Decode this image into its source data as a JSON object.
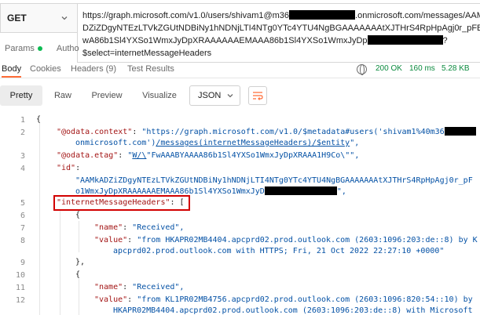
{
  "request": {
    "method": "GET",
    "url_line1_a": "https://graph.microsoft.com/v1.0/users/shivam1@m36",
    "url_line1_b": ".onmicrosoft.com/messages/AAMkA",
    "url_line2": "DZiZDgyNTEzLTVkZGUtNDBiNy1hNDNjLTI4NTg0YTc4YTU4NgBGAAAAAAAtXJTHrS4RpHpAgj0r_pFB",
    "url_line3_a": "wA86b1Sl4YXSo1WmxJyDpXRAAAAAAEMAAA86b1Sl4YXSo1WmxJyDp",
    "url_line3_b": "?",
    "url_line4": "$select=internetMessageHeaders"
  },
  "request_tabs": {
    "params": "Params",
    "auth": "Autho"
  },
  "response_tabs": {
    "body": "Body",
    "cookies": "Cookies",
    "headers": "Headers (9)",
    "test_results": "Test Results",
    "status": "200 OK",
    "time": "160 ms",
    "size": "5.28 KB"
  },
  "format_bar": {
    "pretty": "Pretty",
    "raw": "Raw",
    "preview": "Preview",
    "visualize": "Visualize",
    "format": "JSON"
  },
  "code": {
    "line_numbers": [
      "1",
      "2",
      "3",
      "4",
      "5",
      "6",
      "7",
      "8",
      "9",
      "10",
      "11",
      "12"
    ],
    "l1": "{",
    "l2_key": "\"@odata.context\"",
    "l2_sep": ": ",
    "l2_val": "\"https://graph.microsoft.com/v1.0/$metadata#users('shivam1%40m36",
    "l2_cont_a": "onmicrosoft.com')",
    "l2_cont_b": "/messages(internetMessageHeaders)/$entity",
    "l2_cont_c": "\",",
    "l3_key": "\"@odata.etag\"",
    "l3_sep": ": ",
    "l3_q": "\"",
    "l3_link": "W/\\",
    "l3_val": "\"FwAAABYAAAA86b1Sl4YXSo1WmxJyDpXRAAA1H9Co\\\"\",",
    "l4_key": "\"id\"",
    "l4_sep": ":",
    "l4_val_a": "\"AAMkADZiZDgyNTEzLTVkZGUtNDBiNy1hNDNjLTI4NTg0YTc4YTU4NgBGAAAAAAAtXJTHrS4RpHpAgj0r_pF",
    "l4_val_b": "o1WmxJyDpXRAAAAAAEMAAA86b1Sl4YXSo1WmxJyD",
    "l4_val_c": "\",",
    "l5_key": "\"internetMessageHeaders\"",
    "l5_rest": ": [",
    "l6": "{",
    "l7_key": "\"name\"",
    "l7_val": "\"Received\",",
    "l8_key": "\"value\"",
    "l8_val": "\"from HKAPR02MB4404.apcprd02.prod.outlook.com (2603:1096:203:de::8) by K",
    "l8_cont": "apcprd02.prod.outlook.com with HTTPS; Fri, 21 Oct 2022 22:27:10 +0000\"",
    "l9": "},",
    "l10": "{",
    "l11_key": "\"name\"",
    "l11_val": "\"Received\",",
    "l12_key": "\"value\"",
    "l12_val": "\"from KL1PR02MB4756.apcprd02.prod.outlook.com (2603:1096:820:54::10) by",
    "l12_cont": "HKAPR02MB4404.apcprd02.prod.outlook.com (2603:1096:203:de::8) with Microsoft"
  }
}
